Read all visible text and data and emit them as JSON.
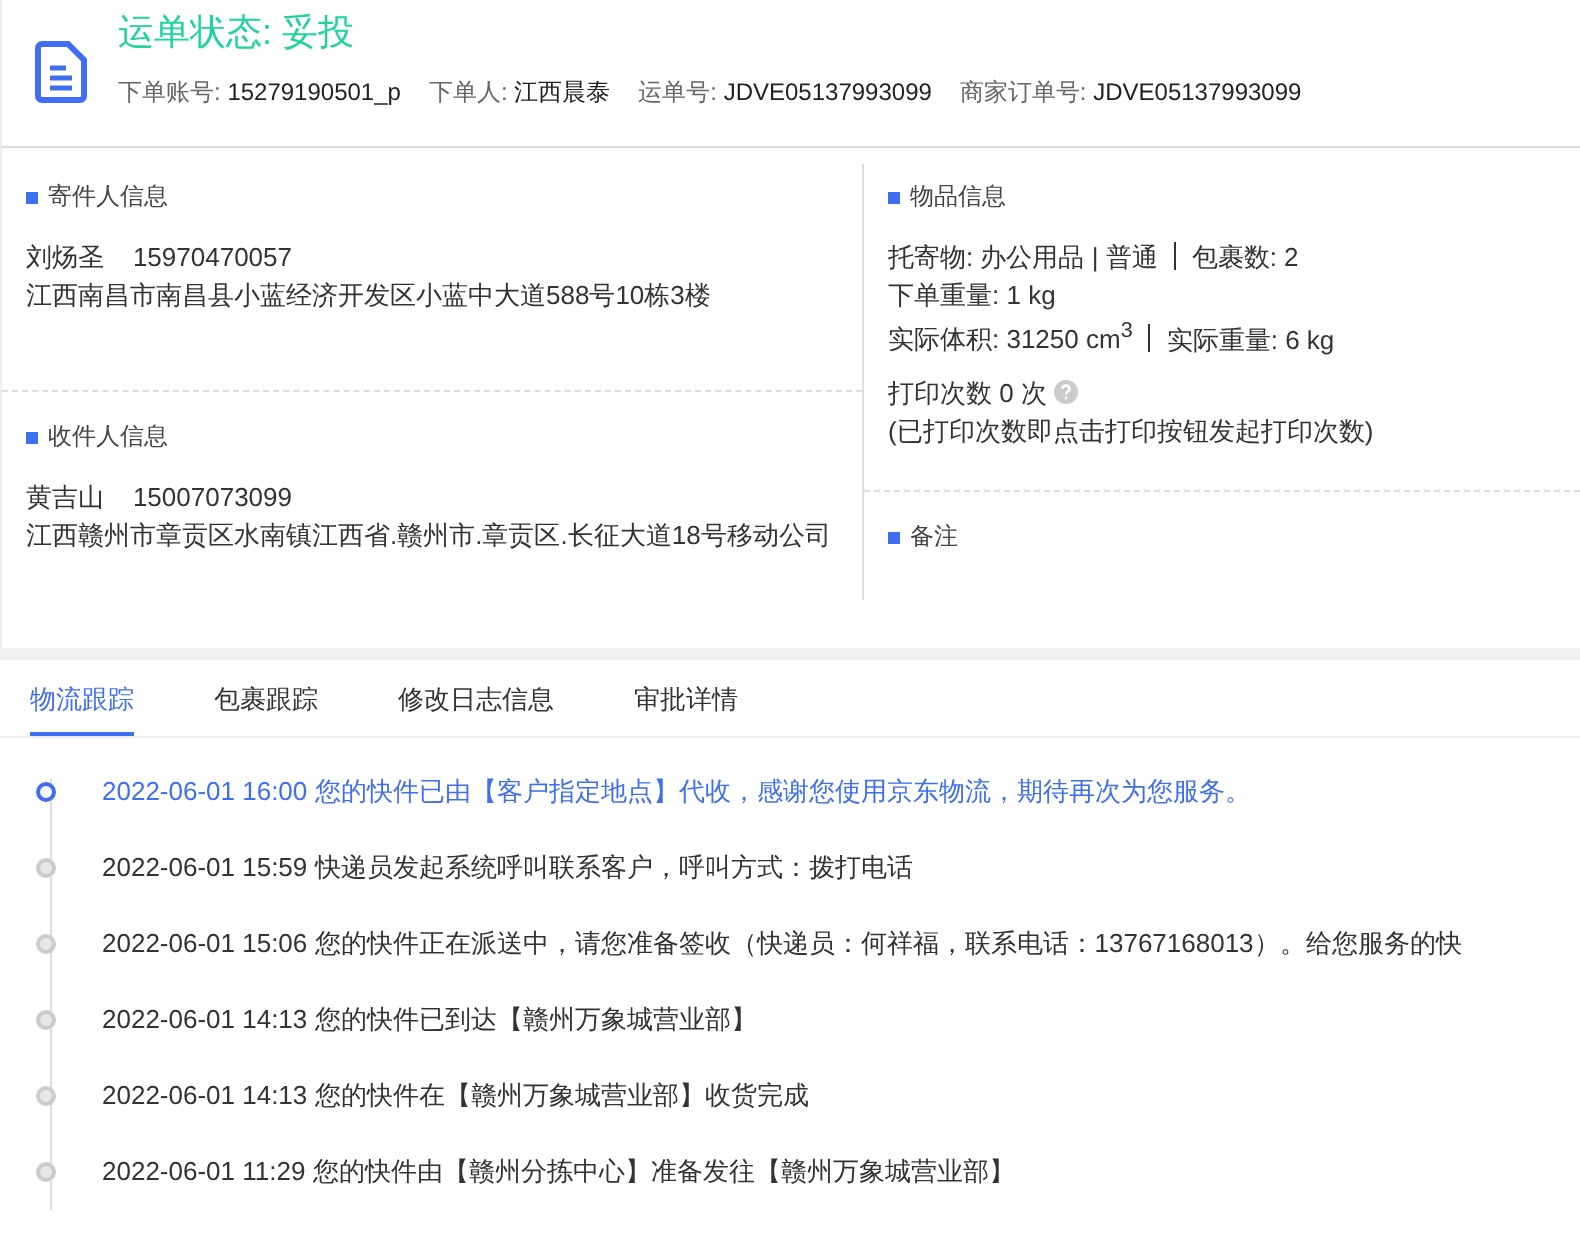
{
  "header": {
    "status_title": "运单状态: 妥投",
    "meta": [
      {
        "label": "下单账号:",
        "value": "15279190501_p"
      },
      {
        "label": "下单人:",
        "value": "江西晨泰"
      },
      {
        "label": "运单号:",
        "value": "JDVE05137993099"
      },
      {
        "label": "商家订单号:",
        "value": "JDVE05137993099"
      }
    ]
  },
  "sender": {
    "title": "寄件人信息",
    "name": "刘炀圣",
    "phone": "15970470057",
    "address": "江西南昌市南昌县小蓝经济开发区小蓝中大道588号10栋3楼"
  },
  "receiver": {
    "title": "收件人信息",
    "name": "黄吉山",
    "phone": "15007073099",
    "address": "江西赣州市章贡区水南镇江西省.赣州市.章贡区.长征大道18号移动公司"
  },
  "goods": {
    "title": "物品信息",
    "lines": [
      [
        "托寄物:  办公用品 | 普通",
        "包裹数:  2"
      ],
      [
        "下单重量:  1 kg"
      ],
      [
        "实际体积:   31250 cm$^{3}$",
        "实际重量:  6 kg"
      ]
    ],
    "print_count": "打印次数   0 次",
    "print_note": "(已打印次数即点击打印按钮发起打印次数)"
  },
  "remarks": {
    "title": "备注"
  },
  "tabs": [
    {
      "label": "物流跟踪",
      "selected": true
    },
    {
      "label": "包裹跟踪",
      "selected": false
    },
    {
      "label": "修改日志信息",
      "selected": false
    },
    {
      "label": "审批详情",
      "selected": false
    }
  ],
  "timeline": [
    {
      "text": "2022-06-01 16:00 您的快件已由【客户指定地点】代收，感谢您使用京东物流，期待再次为您服务。",
      "selected": true
    },
    {
      "text": "2022-06-01 15:59 快递员发起系统呼叫联系客户，呼叫方式：拨打电话",
      "selected": false
    },
    {
      "text": "2022-06-01 15:06 您的快件正在派送中，请您准备签收（快递员：何祥福，联系电话：13767168013）。给您服务的快",
      "selected": false
    },
    {
      "text": "2022-06-01 14:13 您的快件已到达【赣州万象城营业部】",
      "selected": false
    },
    {
      "text": "2022-06-01 14:13 您的快件在【赣州万象城营业部】收货完成",
      "selected": false
    },
    {
      "text": "2022-06-01 11:29 您的快件由【赣州分拣中心】准备发往【赣州万象城营业部】",
      "selected": false
    }
  ]
}
